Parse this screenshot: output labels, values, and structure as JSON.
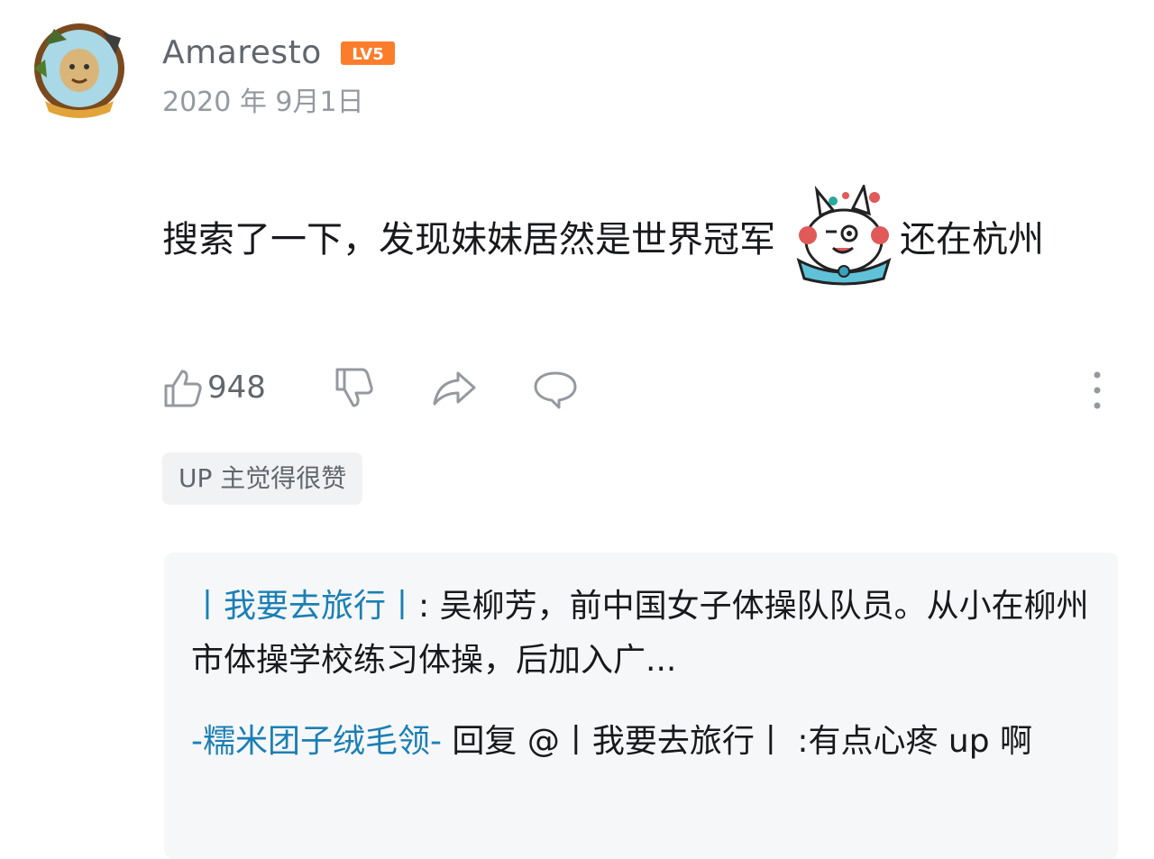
{
  "comment": {
    "username": "Amaresto",
    "level": "LV5",
    "date": "2020 年 9月1日",
    "text_before_sticker": "搜索了一下，发现妹妹居然是世界冠军",
    "text_after_sticker": "还在杭州"
  },
  "actions": {
    "like_count": "948"
  },
  "up_tag": "UP 主觉得很赞",
  "replies": [
    {
      "author": "丨我要去旅行丨",
      "separator": ": ",
      "text": "吴柳芳，前中国女子体操队队员。从小在柳州市体操学校练习体操，后加入广..."
    },
    {
      "author": "-糯米团子绒毛领-",
      "verb": " 回复 @丨我要去旅行丨 ",
      "text": ":有点心疼 up 啊"
    }
  ],
  "colors": {
    "link": "#1b7fb5",
    "level_badge": "#fb7d2c",
    "secondary_text": "#61666d"
  },
  "icons": [
    "like-icon",
    "dislike-icon",
    "share-icon",
    "comment-icon",
    "more-icon"
  ]
}
